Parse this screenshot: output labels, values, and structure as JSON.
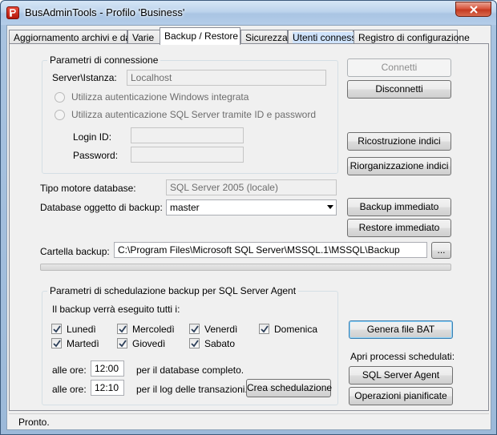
{
  "window": {
    "title": "BusAdminTools - Profilo 'Business'"
  },
  "tabs": [
    "Aggiornamento archivi e dati",
    "Varie",
    "Backup / Restore",
    "Sicurezza",
    "Utenti connessi",
    "Registro di configurazione"
  ],
  "connection": {
    "group_title": "Parametri di connessione",
    "server_label": "Server\\Istanza:",
    "server_value": "Localhost",
    "auth_windows": "Utilizza autenticazione Windows integrata",
    "auth_sql": "Utilizza autenticazione SQL Server tramite ID e password",
    "login_label": "Login ID:",
    "login_value": "",
    "password_label": "Password:",
    "password_value": ""
  },
  "engine": {
    "label": "Tipo motore database:",
    "value": "SQL Server 2005 (locale)"
  },
  "database": {
    "label": "Database oggetto di backup:",
    "value": "master"
  },
  "folder": {
    "label": "Cartella backup:",
    "value": "C:\\Program Files\\Microsoft SQL Server\\MSSQL.1\\MSSQL\\Backup",
    "browse": "..."
  },
  "buttons": {
    "connect": "Connetti",
    "disconnect": "Disconnetti",
    "rebuild": "Ricostruzione indici",
    "reorganize": "Riorganizzazione indici",
    "backup_now": "Backup immediato",
    "restore_now": "Restore immediato",
    "create_schedule": "Crea schedulazione",
    "generate_bat": "Genera file BAT",
    "sql_agent": "SQL Server Agent",
    "scheduled_ops": "Operazioni pianificate"
  },
  "schedule": {
    "group_title": "Parametri di schedulazione backup per SQL Server Agent",
    "intro": "Il backup verrà eseguito tutti i:",
    "days": {
      "mon": "Lunedì",
      "tue": "Martedì",
      "wed": "Mercoledì",
      "thu": "Giovedì",
      "fri": "Venerdì",
      "sat": "Sabato",
      "sun": "Domenica"
    },
    "full_time_label": "alle ore:",
    "full_time": "12:00",
    "full_desc": "per il database completo.",
    "log_time_label": "alle ore:",
    "log_time": "12:10",
    "log_desc": "per il log delle transazioni."
  },
  "open_processes_label": "Apri processi schedulati:",
  "status": "Pronto."
}
